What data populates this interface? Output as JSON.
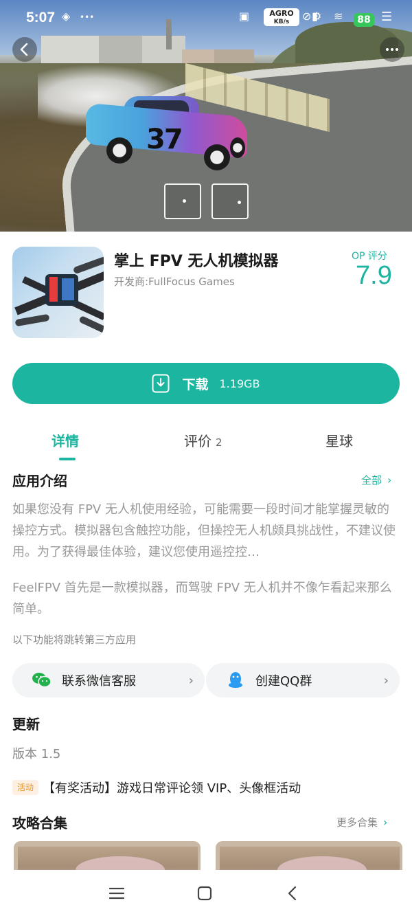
{
  "status_bar": {
    "time": "5:07",
    "speed_top": "AGRO",
    "speed_unit": "KB/s",
    "battery": "88"
  },
  "app": {
    "name": "掌上 FPV 无人机模拟器",
    "developer": "开发商:FullFocus Games",
    "score_label": "OP 评分",
    "score": "7.9"
  },
  "car_number": "37",
  "download": {
    "label": "下载",
    "size": "1.19GB"
  },
  "tabs": [
    {
      "label": "详情",
      "count": ""
    },
    {
      "label": "评价",
      "count": "2"
    },
    {
      "label": "星球",
      "count": ""
    }
  ],
  "intro": {
    "title": "应用介绍",
    "all_link": "全部",
    "paragraph1": "如果您没有 FPV 无人机使用经验，可能需要一段时间才能掌握灵敏的操控方式。模拟器包含触控功能，但操控无人机颇具挑战性，不建议使用。为了获得最佳体验，建议您使用遥控控…",
    "paragraph2": "FeelFPV 首先是一款模拟器，而驾驶 FPV 无人机并不像乍看起来那么简单。",
    "third_party_note": "以下功能将跳转第三方应用"
  },
  "contacts": {
    "wechat": "联系微信客服",
    "qq": "创建QQ群"
  },
  "update": {
    "title": "更新",
    "version": "版本 1.5",
    "activity_badge": "活动",
    "activity_text": "【有奖活动】游戏日常评论领 VIP、头像框活动"
  },
  "guides": {
    "title": "攻略合集",
    "more_link": "更多合集"
  },
  "colors": {
    "accent": "#1cb59f",
    "activity_badge_bg": "#fdf0e2",
    "activity_badge_fg": "#e8962a"
  },
  "icons": [
    "back-icon",
    "more-icon",
    "download-icon",
    "wechat-icon",
    "qq-icon",
    "chevron-right-icon",
    "menu-icon",
    "home-icon"
  ]
}
